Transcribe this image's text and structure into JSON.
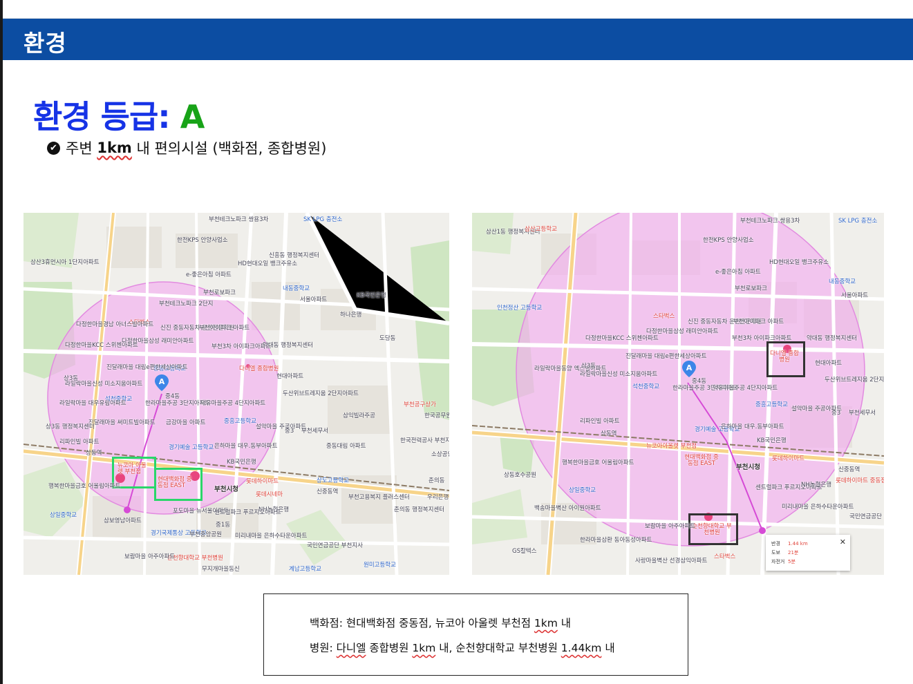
{
  "header": {
    "title": "환경"
  },
  "grade": {
    "label": "환경 등급:",
    "value": "A"
  },
  "bullet": {
    "pre": "주변 ",
    "km": "1km",
    "post": " 내 편의시설 (백화점, 종합병원)"
  },
  "colors": {
    "header_bg": "#0c4da2",
    "grade_label": "#1633e6",
    "grade_value": "#18a318",
    "radius_fill": "#f4a8f0",
    "highlight_green": "#2ad66a"
  },
  "map1": {
    "pin": "A",
    "labels": [
      "부천테크노파크 쌍용3차",
      "SK LPG 충전소",
      "한전KPS 안양사업소",
      "신흥동 행정복지센터",
      "HD현대오일 뱅크주유소",
      "삼산3휴먼시아 1단지아파트",
      "e-좋은아침 아파트",
      "부천로보파크",
      "부천테크노파크 2단지",
      "내동중학교",
      "서울아파트",
      "KB국민은행",
      "하나은행",
      "도당동",
      "스타벅스",
      "신진 중동자동차 운전전문학원",
      "부천아이파크 아파트",
      "다정한마을경남 아너스빌아파트",
      "다정한마을KCC 스위첸아파트",
      "다정한마을삼성 래미안아파트",
      "부천3차 아이파크아파트",
      "약대동 행정복지센터",
      "다니엘 종합병원",
      "현대아파트",
      "중동고등학교",
      "진달래마을 대림e편한세상아파트",
      "상3동",
      "라일락마을신성 미소지움아파트",
      "석천중학교",
      "중4동",
      "한라마을주공 3단지아파트",
      "덕유마을주공 4단지아파트",
      "두산위브트레지움 2단지아파트",
      "중흥고등학교",
      "설악마을 주공아파트",
      "중3",
      "부천세무서",
      "라일락마을 대우유림아파트",
      "진달래마을 써미트빌아파트",
      "금강마을 아파트",
      "경기예술 고등학교",
      "은하마을 대우.동부아파트",
      "KB국민은행",
      "상3동 행정복지센터",
      "리파인빌 아파트",
      "상동역",
      "부천시청",
      "뉴코아 아울렛 부천점",
      "현대백화점 중동점 EAST",
      "롯데하이마트",
      "행복한마을금호 어울림아파트",
      "신중동역",
      "롯데시네마",
      "NH농협은행",
      "포도마을 뉴서울아파트",
      "센트럴파크 푸르지오아파트",
      "미리내마을 은하수타운아파트",
      "삼보영남아파트",
      "상일중학교",
      "경기국제통상 고등학교",
      "부천중앙공원",
      "중1동",
      "순천향대학교 부천병원",
      "보람마을 아주아파트",
      "무지개마을동신",
      "상도고등학교",
      "춘의동",
      "한국전력공사 부천지사",
      "소상공인",
      "삼익빌라주공",
      "중동대림 아파트",
      "한국공무원 부천세조원",
      "부천공구상가",
      "국민연금공단 부천지사",
      "계남고등학교",
      "원미고등학교",
      "부천고용복지 플러스센터",
      "우리은행",
      "춘의동 행정복지센터"
    ]
  },
  "map2": {
    "pin": "A",
    "labels": [
      "부천테크노파크 쌍용3차",
      "SK LPG 충전소",
      "삼산1동 행정복지센터",
      "삼산고등학교",
      "한전KPS 안양사업소",
      "HD현대오일 뱅크주유소",
      "e-좋은아침 아파트",
      "부천로보파크",
      "내동중학교",
      "서울아파트",
      "인천정산 고등학교",
      "스타벅스",
      "신진 중동자동차 운전전문학원",
      "부천아이파크 아파트",
      "다정한마을KCC 스위첸아파트",
      "다정한마을삼성 래미안아파트",
      "부천3차 아이파크아파트",
      "약대동 행정복지센터",
      "다니엘 종합병원",
      "현대아파트",
      "진달래마을 대림e편한세상아파트",
      "라일락마을동양 엑스빌아파트",
      "상3동",
      "라일락마을신성 미소지움아파트",
      "석천중학교",
      "중4동",
      "한라마을주공 3단지아파트",
      "덕유마을주공 4단지아파트",
      "두산위브트레지움 2단지아파트",
      "설악마을 주공아파트",
      "중3",
      "부천세무서",
      "중흥고등학교",
      "리파인빌 아파트",
      "상동역",
      "경기예술 고등학교",
      "은하마을 대우.동부아파트",
      "KB국민은행",
      "부천시청",
      "뉴코아아울렛 부천점",
      "현대백화점 중동점 EAST",
      "롯데하이마트",
      "행복한마을금호 어울림아파트",
      "신중동역",
      "센트럴파크 푸르지오아파트",
      "미리내마을 은하수타운아파트",
      "순천향대학교 부천병원",
      "보람마을 아주아파트",
      "스타벅스",
      "백송마을벽산 아이원아파트",
      "상일중학교",
      "GS칼텍스",
      "한라마을삼환 동아동성아파트",
      "사랑마을벽산 선경삼익아파트",
      "국민연금공단 부천지사",
      "롯데하이마트 중동점",
      "NH농협은행",
      "상동호수공원"
    ],
    "popup": {
      "rows": [
        {
          "k": "반경",
          "v": "1.44 km"
        },
        {
          "k": "도보",
          "v": "21분"
        },
        {
          "k": "자전거",
          "v": "5분"
        }
      ]
    }
  },
  "note": {
    "line1": {
      "a": "백화점: 현대백화점 중동점, 뉴코아 아울렛 부천점 ",
      "u": "1km",
      "b": " 내"
    },
    "line2": {
      "a": "병원: ",
      "u1": "다니엘",
      "b": " 종합병원 ",
      "u2": "1km",
      "c": " 내, 순천향대학교 부천병원 ",
      "u3": "1.44km",
      "d": " 내"
    }
  }
}
